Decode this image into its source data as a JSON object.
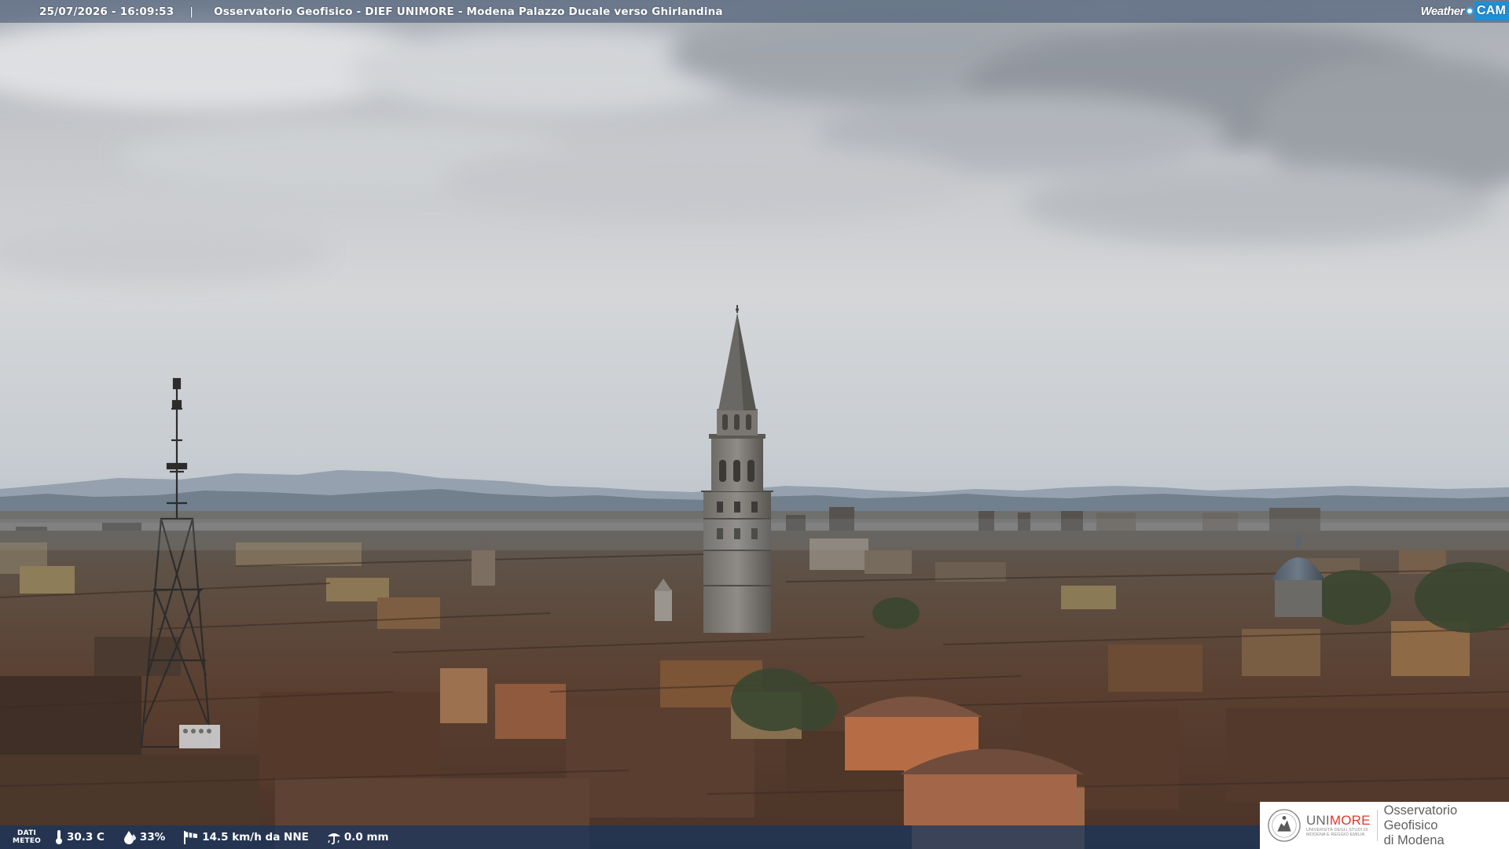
{
  "overlay": {
    "timestamp": "25/07/2026 - 16:09:53",
    "separator": "|",
    "caption": "Osservatorio Geofisico - DIEF UNIMORE - Modena Palazzo Ducale verso Ghirlandina"
  },
  "logo": {
    "weather": "Weather",
    "cam": "CAM",
    "accent_color": "#1f8fd6"
  },
  "weather_bar": {
    "label_line1": "DATI",
    "label_line2": "METEO",
    "temperature": "30.3 C",
    "humidity": "33%",
    "wind": "14.5 km/h da NNE",
    "rain": "0.0 mm",
    "icons": [
      "thermometer-icon",
      "humidity-drop-icon",
      "wind-sock-icon",
      "rain-gauge-icon"
    ]
  },
  "unimore": {
    "name_part1": "UNI",
    "name_part2": "MORE",
    "subtitle_line1": "UNIVERSITÀ DEGLI STUDI DI",
    "subtitle_line2": "MODENA E REGGIO EMILIA",
    "observatory_line1": "Osservatorio Geofisico",
    "observatory_line2": "di Modena",
    "accent_color": "#e2382a"
  },
  "scene": {
    "description_icons": [
      "ghirlandina-tower",
      "antenna-mast",
      "dome",
      "mountains",
      "clouds"
    ],
    "sky_color": "#c9ccd0",
    "roof_color": "#5e4636"
  }
}
